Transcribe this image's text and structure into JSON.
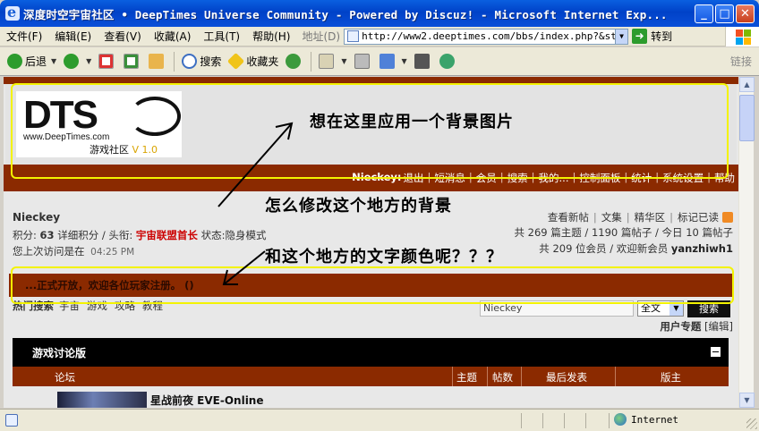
{
  "window": {
    "title": "深度时空宇宙社区 • DeepTimes Universe Community - Powered by Discuz! - Microsoft Internet Exp...",
    "min": "_",
    "max": "□",
    "close": "✕"
  },
  "menu": {
    "items": [
      "文件(F)",
      "编辑(E)",
      "查看(V)",
      "收藏(A)",
      "工具(T)",
      "帮助(H)"
    ],
    "address_label": "地址(D)",
    "address": "http://www2.deeptimes.com/bbs/index.php?&style:",
    "go_label": "转到"
  },
  "toolbar": {
    "back": "后退",
    "search": "搜索",
    "favorites": "收藏夹",
    "links": "链接"
  },
  "colors": {
    "accent": "#8b2a00",
    "annotation": "#f3f300",
    "rank": "#cc0000"
  },
  "site": {
    "logo": {
      "mark": "DTS",
      "url": "www.DeepTimes.com",
      "subtitle": "游戏社区",
      "version": "V 1.0"
    },
    "nav": {
      "user": "Nieckey:",
      "links": [
        "退出",
        "短消息",
        "会员",
        "搜索",
        "我的...",
        "控制面板",
        "统计",
        "系统设置",
        "帮助"
      ]
    },
    "user": {
      "name": "Nieckey",
      "points_label": "积分:",
      "points": "63",
      "points_desc": "详细积分 / 头衔:",
      "rank": "宇宙联盟首长",
      "status_label": "状态:",
      "status": "隐身模式",
      "last_visit_label": "您上次访问是在",
      "last_visit": "04:25 PM"
    },
    "quick_links": [
      "查看新帖",
      "文集",
      "精华区",
      "标记已读"
    ],
    "stats_line1": "共 269 篇主题 / 1190 篇帖子 / 今日 10 篇帖子",
    "stats_line2_prefix": "共 209 位会员 / 欢迎新会员",
    "newest_member": "yanzhiwh1",
    "welcome": "...正式开放，欢迎各位玩家注册。 ()",
    "hot_search": {
      "label": "热门搜索",
      "keywords": [
        "宇宙",
        "游戏",
        "攻略",
        "教程"
      ]
    },
    "search": {
      "value": "Nieckey",
      "scope": "全文",
      "button": "搜索"
    },
    "special": {
      "label": "用户专题",
      "edit": "[编辑]"
    },
    "forum_section": {
      "title": "游戏讨论版",
      "columns": [
        "论坛",
        "主题",
        "帖数",
        "最后发表",
        "版主"
      ],
      "rows": [
        {
          "name": "星战前夜 EVE-Online"
        }
      ]
    }
  },
  "annotations": {
    "bg_image": "想在这里应用一个背景图片",
    "bg_change": "怎么修改这个地方的背景",
    "text_color": "和这个地方的文字颜色呢？？？"
  },
  "status": {
    "zone": "Internet"
  }
}
